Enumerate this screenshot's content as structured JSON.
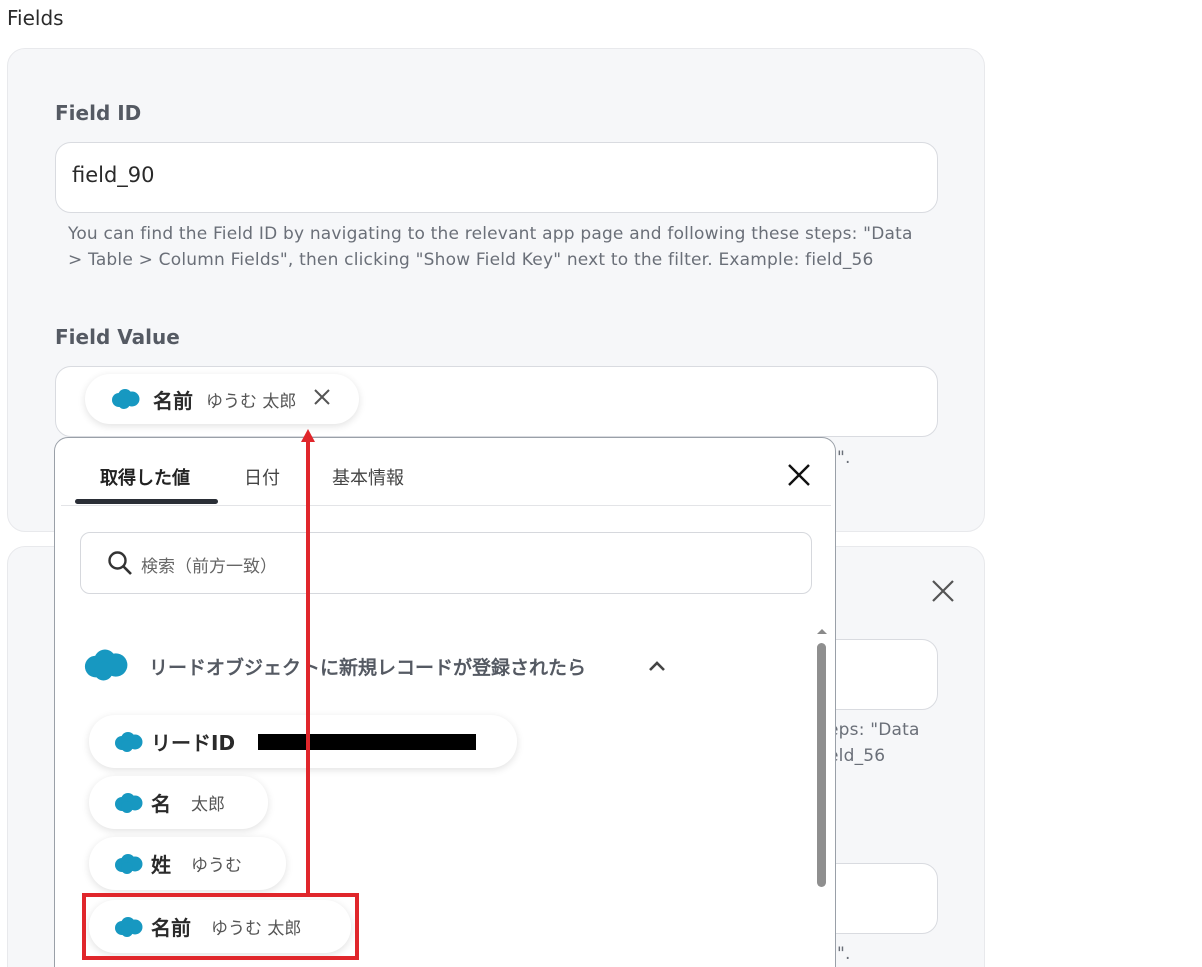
{
  "section": {
    "title": "Fields"
  },
  "field1": {
    "id_label": "Field ID",
    "id_value": "field_90",
    "help_line1": "You can find the Field ID by navigating to the relevant app page and following these steps: \"Data",
    "help_line2": "> Table > Column Fields\", then clicking \"Show Field Key\" next to the filter. Example: field_56",
    "value_label": "Field Value",
    "value_chip": {
      "key": "名前",
      "value": "ゆうむ 太郎",
      "icon": "salesforce-cloud-icon"
    }
  },
  "field2": {
    "help_fragment1": "eps: \"Data",
    "help_fragment2": "eld_56",
    "quote_fragment": "\".",
    "quote_fragment_top": "\"."
  },
  "dropdown": {
    "tabs": [
      {
        "label": "取得した値",
        "active": true
      },
      {
        "label": "日付",
        "active": false
      },
      {
        "label": "基本情報",
        "active": false
      }
    ],
    "search_placeholder": "検索（前方一致）",
    "group": {
      "title": "リードオブジェクトに新規レコードが登録されたら",
      "icon": "salesforce-cloud-icon",
      "expanded": true
    },
    "items": [
      {
        "key": "リードID",
        "value": ""
      },
      {
        "key": "名",
        "value": "太郎"
      },
      {
        "key": "姓",
        "value": "ゆうむ"
      },
      {
        "key": "名前",
        "value": "ゆうむ 太郎"
      }
    ]
  },
  "colors": {
    "highlight": "#e0262b",
    "salesforce": "#1798c1",
    "card_bg": "#f6f7f9"
  }
}
